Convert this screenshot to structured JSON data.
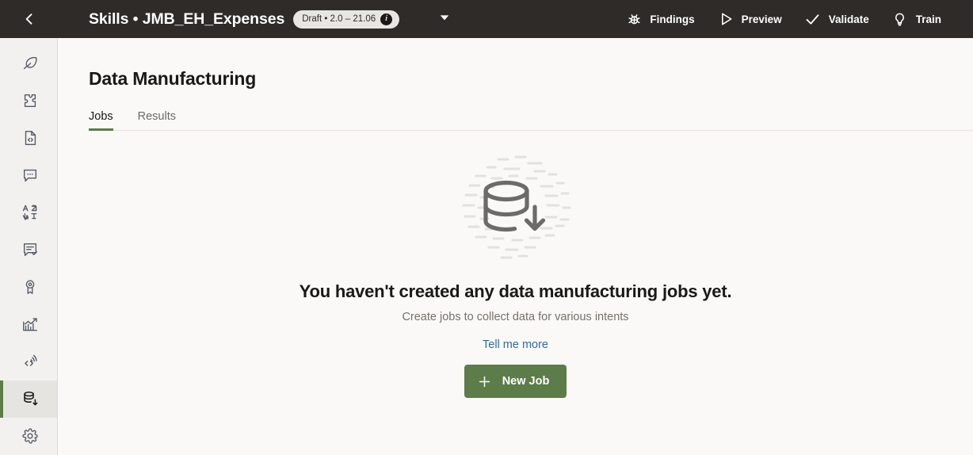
{
  "header": {
    "back_icon": "chevron-left-icon",
    "title": "Skills • JMB_EH_Expenses",
    "badge": {
      "label": "Draft • 2.0 – 21.06",
      "info_icon": "info-icon",
      "info_glyph": "i"
    },
    "dropdown_icon": "chevron-down-icon",
    "actions": [
      {
        "label": "Findings",
        "icon": "bug-icon"
      },
      {
        "label": "Preview",
        "icon": "play-icon"
      },
      {
        "label": "Validate",
        "icon": "check-icon"
      },
      {
        "label": "Train",
        "icon": "lightbulb-icon"
      }
    ]
  },
  "sidebar": {
    "items": [
      {
        "name": "sidebar-item-authoring",
        "icon": "feather-icon",
        "active": false
      },
      {
        "name": "sidebar-item-extensions",
        "icon": "puzzle-piece-icon",
        "active": false
      },
      {
        "name": "sidebar-item-code-file",
        "icon": "file-code-icon",
        "active": false
      },
      {
        "name": "sidebar-item-conversations",
        "icon": "chat-bubble-icon",
        "active": false
      },
      {
        "name": "sidebar-item-translation",
        "icon": "translate-icon",
        "active": false
      },
      {
        "name": "sidebar-item-annotations",
        "icon": "chat-check-icon",
        "active": false
      },
      {
        "name": "sidebar-item-quality",
        "icon": "award-ribbon-icon",
        "active": false
      },
      {
        "name": "sidebar-item-analytics",
        "icon": "chart-trend-icon",
        "active": false
      },
      {
        "name": "sidebar-item-api",
        "icon": "code-broadcast-icon",
        "active": false
      },
      {
        "name": "sidebar-item-data-manufacturing",
        "icon": "database-download-icon",
        "active": true
      },
      {
        "name": "sidebar-item-settings",
        "icon": "gear-icon",
        "active": false
      }
    ]
  },
  "main": {
    "page_title": "Data Manufacturing",
    "tabs": [
      {
        "label": "Jobs",
        "active": true
      },
      {
        "label": "Results",
        "active": false
      }
    ],
    "empty_state": {
      "illustration_icon": "database-download-illustration",
      "heading": "You haven't created any data manufacturing jobs yet.",
      "subtext": "Create jobs to collect data for various intents",
      "link_label": "Tell me more",
      "button_label": "New Job",
      "button_icon": "plus-icon"
    }
  },
  "colors": {
    "header_bg": "#2e2b28",
    "sidebar_bg": "#f2f1ef",
    "main_bg": "#faf9f7",
    "accent_green": "#5c7c4a",
    "link_blue": "#2d6da3",
    "badge_bg": "#e8e6e3",
    "muted_text": "#75716c",
    "illustration_stroke": "#6b6b68"
  }
}
